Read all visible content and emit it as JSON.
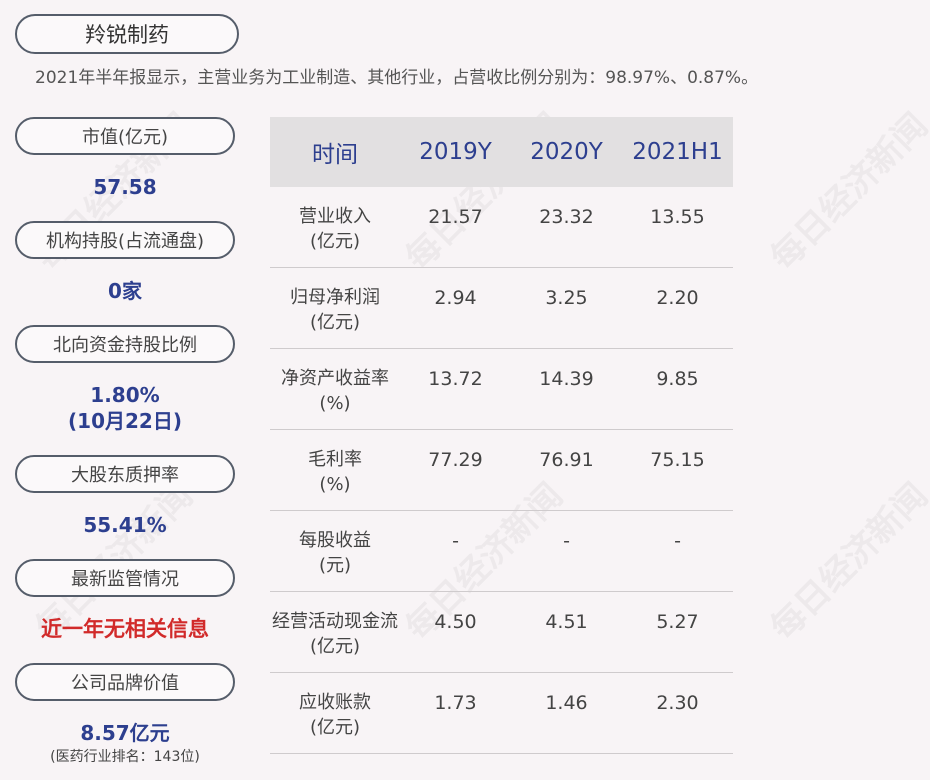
{
  "company": "羚锐制药",
  "summary": "2021年半年报显示，主营业务为工业制造、其他行业，占营收比例分别为：98.97%、0.87%。",
  "left": [
    {
      "label": "市值(亿元)",
      "value": "57.58"
    },
    {
      "label": "机构持股(占流通盘)",
      "value": "0家"
    },
    {
      "label": "北向资金持股比例",
      "value": "1.80%",
      "value2": "(10月22日)"
    },
    {
      "label": "大股东质押率",
      "value": "55.41%"
    },
    {
      "label": "最新监管情况",
      "value": "近一年无相关信息"
    },
    {
      "label": "公司品牌价值",
      "value": "8.57亿元",
      "note": "(医药行业排名：143位)"
    }
  ],
  "table": {
    "headers": [
      "时间",
      "2019Y",
      "2020Y",
      "2021H1"
    ],
    "rows": [
      {
        "name": "营业收入",
        "unit": "(亿元)",
        "values": [
          "21.57",
          "23.32",
          "13.55"
        ]
      },
      {
        "name": "归母净利润",
        "unit": "(亿元)",
        "values": [
          "2.94",
          "3.25",
          "2.20"
        ]
      },
      {
        "name": "净资产收益率",
        "unit": "(%)",
        "values": [
          "13.72",
          "14.39",
          "9.85"
        ]
      },
      {
        "name": "毛利率",
        "unit": "(%)",
        "values": [
          "77.29",
          "76.91",
          "75.15"
        ]
      },
      {
        "name": "每股收益",
        "unit": "(元)",
        "values": [
          "-",
          "-",
          "-"
        ]
      },
      {
        "name": "经营活动现金流",
        "unit": "(亿元)",
        "values": [
          "4.50",
          "4.51",
          "5.27"
        ]
      },
      {
        "name": "应收账款",
        "unit": "(亿元)",
        "values": [
          "1.73",
          "1.46",
          "2.30"
        ]
      }
    ]
  },
  "watermark": "每日经济新闻"
}
